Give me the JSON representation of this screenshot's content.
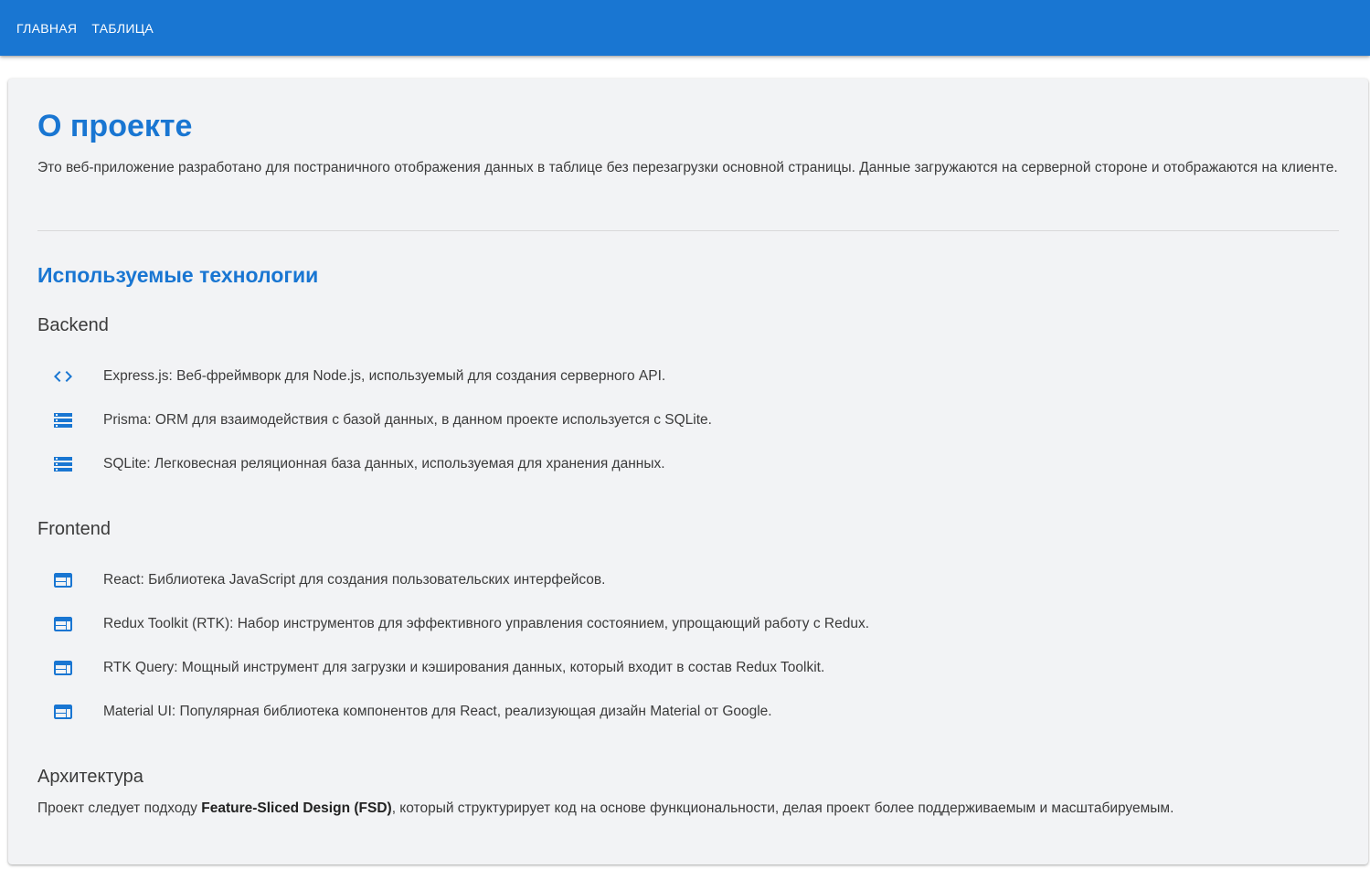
{
  "nav": {
    "items": [
      {
        "label": "ГЛАВНАЯ"
      },
      {
        "label": "ТАБЛИЦА"
      }
    ]
  },
  "colors": {
    "primary": "#1976d2",
    "paper_background": "#f2f3f5",
    "text": "#3b3b3b"
  },
  "about": {
    "title": "О проекте",
    "intro": "Это веб-приложение разработано для постраничного отображения данных в таблице без перезагрузки основной страницы. Данные загружаются на серверной стороне и отображаются на клиенте."
  },
  "technologies": {
    "title": "Используемые технологии",
    "backend": {
      "title": "Backend",
      "items": [
        {
          "icon": "code-icon",
          "text": "Express.js: Веб-фреймворк для Node.js, используемый для создания серверного API."
        },
        {
          "icon": "storage-icon",
          "text": "Prisma: ORM для взаимодействия с базой данных, в данном проекте используется с SQLite."
        },
        {
          "icon": "storage-icon",
          "text": "SQLite: Легковесная реляционная база данных, используемая для хранения данных."
        }
      ]
    },
    "frontend": {
      "title": "Frontend",
      "items": [
        {
          "icon": "web-icon",
          "text": "React: Библиотека JavaScript для создания пользовательских интерфейсов."
        },
        {
          "icon": "web-icon",
          "text": "Redux Toolkit (RTK): Набор инструментов для эффективного управления состоянием, упрощающий работу с Redux."
        },
        {
          "icon": "web-icon",
          "text": "RTK Query: Мощный инструмент для загрузки и кэширования данных, который входит в состав Redux Toolkit."
        },
        {
          "icon": "web-icon",
          "text": "Material UI: Популярная библиотека компонентов для React, реализующая дизайн Material от Google."
        }
      ]
    }
  },
  "architecture": {
    "title": "Архитектура",
    "text_before": "Проект следует подходу ",
    "text_bold": "Feature-Sliced Design (FSD)",
    "text_after": ", который структурирует код на основе функциональности, делая проект более поддерживаемым и масштабируемым."
  }
}
